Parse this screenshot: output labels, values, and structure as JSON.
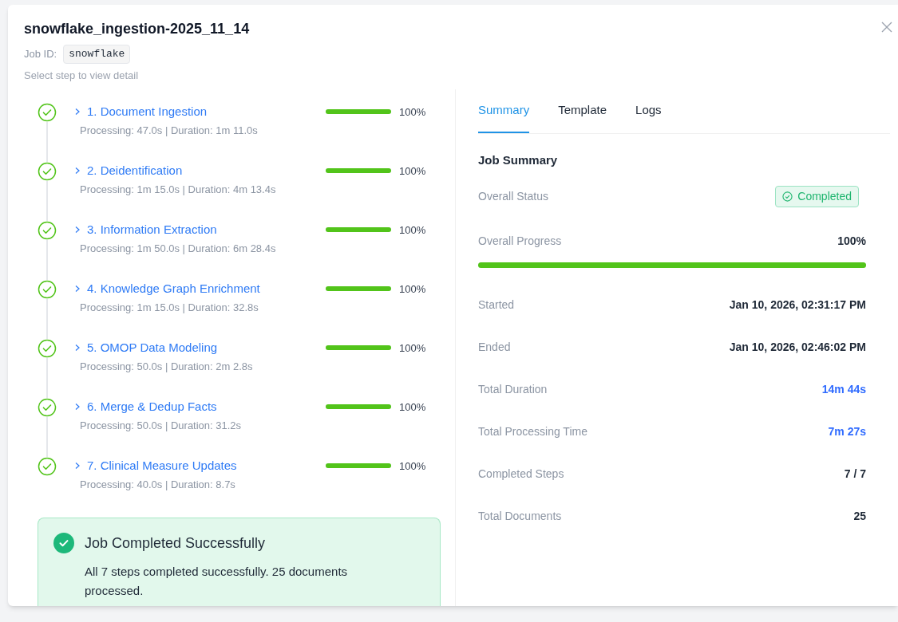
{
  "dialog": {
    "title": "snowflake_ingestion-2025_11_14",
    "job_id_label": "Job ID:",
    "job_id": "snowflake",
    "hint": "Select step to view detail"
  },
  "steps": [
    {
      "name": "1. Document Ingestion",
      "detail": "Processing: 47.0s | Duration: 1m 11.0s",
      "level": 1,
      "percent": "100%",
      "done": true
    },
    {
      "name": "2. Deidentification",
      "detail": "Processing: 1m 15.0s | Duration: 4m 13.4s",
      "level": 1,
      "percent": "100%",
      "done": true
    },
    {
      "name": "3. Information Extraction",
      "detail": "Processing: 1m 50.0s | Duration: 6m 28.4s",
      "level": 1,
      "percent": "100%",
      "done": true
    },
    {
      "name": "4. Knowledge Graph Enrichment",
      "detail": "Processing: 1m 15.0s | Duration: 32.8s",
      "level": 1,
      "percent": "100%",
      "done": true
    },
    {
      "name": "5. OMOP Data Modeling",
      "detail": "Processing: 50.0s | Duration: 2m 2.8s",
      "level": 1,
      "percent": "100%",
      "done": true
    },
    {
      "name": "6. Merge & Dedup Facts",
      "detail": "Processing: 50.0s | Duration: 31.2s",
      "level": 1,
      "percent": "100%",
      "done": true
    },
    {
      "name": "7. Clinical Measure Updates",
      "detail": "Processing: 40.0s | Duration: 8.7s",
      "level": 1,
      "percent": "100%",
      "done": true
    }
  ],
  "alert": {
    "title": "Job Completed Successfully",
    "message": "All 7 steps completed successfully. 25 documents processed."
  },
  "tabs": [
    {
      "label": "Summary",
      "selected": true
    },
    {
      "label": "Template",
      "selected": false
    },
    {
      "label": "Logs",
      "selected": false
    }
  ],
  "summary": {
    "heading": "Job Summary",
    "rows": [
      {
        "kind": "status",
        "label": "Overall Status",
        "value": "Completed"
      },
      {
        "kind": "progress",
        "label": "Overall Progress",
        "value": "100%",
        "level": 1
      },
      {
        "kind": "value",
        "label": "Started",
        "value": "Jan 10, 2026, 02:31:17 PM"
      },
      {
        "kind": "value",
        "label": "Ended",
        "value": "Jan 10, 2026, 02:46:02 PM"
      },
      {
        "kind": "accent",
        "label": "Total Duration",
        "value": "14m 44s"
      },
      {
        "kind": "accent",
        "label": "Total Processing Time",
        "value": "7m 27s"
      },
      {
        "kind": "value",
        "label": "Completed Steps",
        "value": "7 / 7"
      },
      {
        "kind": "value",
        "label": "Total Documents",
        "value": "25"
      }
    ]
  }
}
